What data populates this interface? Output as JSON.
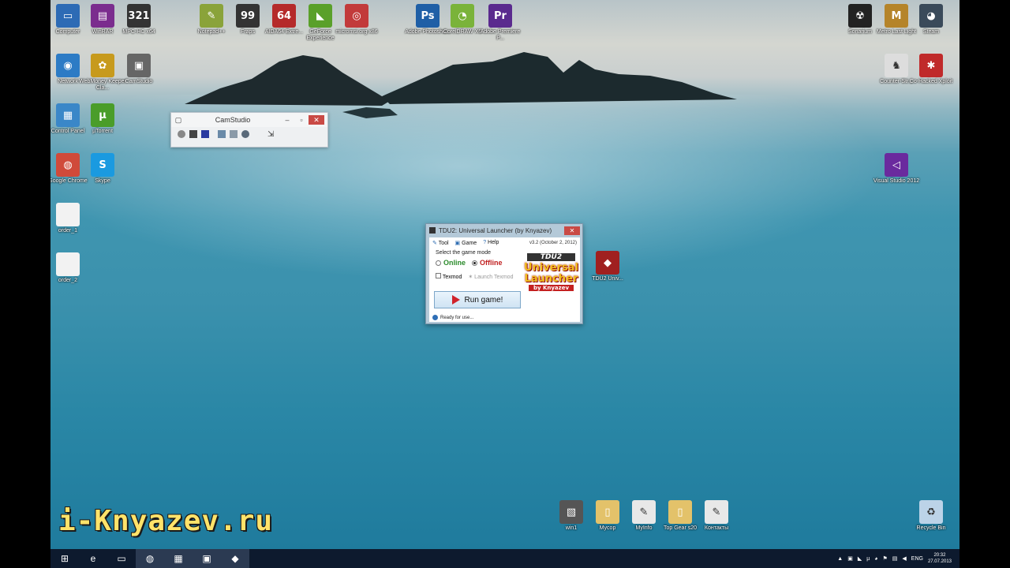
{
  "desktop_icons_left": [
    {
      "label": "Computer",
      "icon": "computer-icon",
      "color": "#2d6bb5",
      "glyph": "▭"
    },
    {
      "label": "WinRAR",
      "icon": "winrar-icon",
      "color": "#7b2d8e",
      "glyph": "▤"
    },
    {
      "label": "MPC-HC x64",
      "icon": "mpc-icon",
      "color": "#333333",
      "glyph": "321"
    },
    {
      "label": "Network",
      "icon": "network-icon",
      "color": "#2d7bc5",
      "glyph": "◉"
    },
    {
      "label": "WebMoney Keeper Cla...",
      "icon": "webmoney-icon",
      "color": "#c79a1d",
      "glyph": "✿"
    },
    {
      "label": "CamStudio",
      "icon": "camstudio-icon",
      "color": "#666666",
      "glyph": "▣"
    },
    {
      "label": "Control Panel",
      "icon": "control-panel-icon",
      "color": "#3a87c8",
      "glyph": "▦"
    },
    {
      "label": "µTorrent",
      "icon": "utorrent-icon",
      "color": "#4a9d2a",
      "glyph": "µ"
    },
    {
      "label": "Google Chrome",
      "icon": "chrome-icon",
      "color": "#d04a3a",
      "glyph": "◍"
    },
    {
      "label": "Skype",
      "icon": "skype-icon",
      "color": "#1a9ae0",
      "glyph": "S"
    },
    {
      "label": "order_1",
      "icon": "document-icon",
      "color": "#f2f2f2",
      "glyph": ""
    },
    {
      "label": "order_2",
      "icon": "document-icon",
      "color": "#f2f2f2",
      "glyph": ""
    }
  ],
  "desktop_icons_top": [
    {
      "label": "Notepad++",
      "icon": "notepad-icon",
      "color": "#8aa33a",
      "glyph": "✎"
    },
    {
      "label": "Fraps",
      "icon": "fraps-icon",
      "color": "#333333",
      "glyph": "99"
    },
    {
      "label": "AIDA64 Extre...",
      "icon": "aida64-icon",
      "color": "#b52a2a",
      "glyph": "64"
    },
    {
      "label": "GeForce Experience",
      "icon": "geforce-icon",
      "color": "#5aa02a",
      "glyph": "◣"
    },
    {
      "label": "micromsi.org x86",
      "icon": "msi-icon",
      "color": "#c23a3a",
      "glyph": "◎"
    },
    {
      "label": "Adobe Photosho...",
      "icon": "photoshop-icon",
      "color": "#1f5fa6",
      "glyph": "Ps"
    },
    {
      "label": "CorelDRAW X6",
      "icon": "coreldraw-icon",
      "color": "#7ab33a",
      "glyph": "◔"
    },
    {
      "label": "Adobe Premiere P...",
      "icon": "premiere-icon",
      "color": "#5a2a8e",
      "glyph": "Pr"
    }
  ],
  "desktop_icons_right": [
    {
      "label": "Sonarium",
      "icon": "sonarium-icon",
      "color": "#222222",
      "glyph": "☢"
    },
    {
      "label": "Metro Last Light",
      "icon": "metro-icon",
      "color": "#b5842a",
      "glyph": "M"
    },
    {
      "label": "Steam",
      "icon": "steam-icon",
      "color": "#3a4a5a",
      "glyph": "◕"
    },
    {
      "label": "Counter-Str...",
      "icon": "counter-strike-icon",
      "color": "#dddddd",
      "glyph": "♞"
    },
    {
      "label": "Co-Hacked Xploit",
      "icon": "game-icon",
      "color": "#c02a2a",
      "glyph": "✱"
    },
    {
      "label": "Visual Studio 2012",
      "icon": "visual-studio-icon",
      "color": "#6a2a9e",
      "glyph": "◁"
    }
  ],
  "tdu_shortcut": {
    "label": "TDU2 Univ...",
    "icon": "tdu2-icon"
  },
  "desktop_icons_bottom": [
    {
      "label": "win1",
      "icon": "image-icon",
      "color": "#555555",
      "glyph": "▧"
    },
    {
      "label": "Мусор",
      "icon": "folder-icon",
      "color": "#e3c26a",
      "glyph": "▯"
    },
    {
      "label": "MyInfo",
      "icon": "notepad-icon",
      "color": "#e8e8e8",
      "glyph": "✎"
    },
    {
      "label": "Top Gear s20",
      "icon": "folder-icon",
      "color": "#e3c26a",
      "glyph": "▯"
    },
    {
      "label": "Контакты",
      "icon": "notepad-icon",
      "color": "#e8e8e8",
      "glyph": "✎"
    },
    {
      "label": "Recycle Bin",
      "icon": "recycle-bin-icon",
      "color": "#bcd3e8",
      "glyph": "♻"
    }
  ],
  "camstudio": {
    "title": "CamStudio"
  },
  "launcher": {
    "title": "TDU2: Universal Launcher (by Knyazev)",
    "menu": [
      "Tool",
      "Game",
      "Help"
    ],
    "version": "v3.2 (October 2, 2012)",
    "mode_label": "Select the game mode",
    "online": "Online",
    "offline": "Offline",
    "texmod": "Texmod",
    "launch_texmod": "Launch Texmod",
    "run": "Run game!",
    "status": "Ready for use...",
    "logo_top": "TDU2",
    "logo_main1": "Universal",
    "logo_main2": "Launcher",
    "logo_by": "by Knyazev"
  },
  "watermark": "i-Knyazev.ru",
  "taskbar": {
    "lang": "ENG",
    "time": "20:32",
    "date": "27.07.2013",
    "items": [
      {
        "name": "start-button",
        "glyph": "⊞"
      },
      {
        "name": "ie-icon",
        "glyph": "e"
      },
      {
        "name": "explorer-icon",
        "glyph": "▭"
      },
      {
        "name": "chrome-taskbar-icon",
        "glyph": "◍"
      },
      {
        "name": "mpc-taskbar-icon",
        "glyph": "▦"
      },
      {
        "name": "camstudio-taskbar-icon",
        "glyph": "▣"
      },
      {
        "name": "tdu2-taskbar-icon",
        "glyph": "◆"
      }
    ]
  }
}
